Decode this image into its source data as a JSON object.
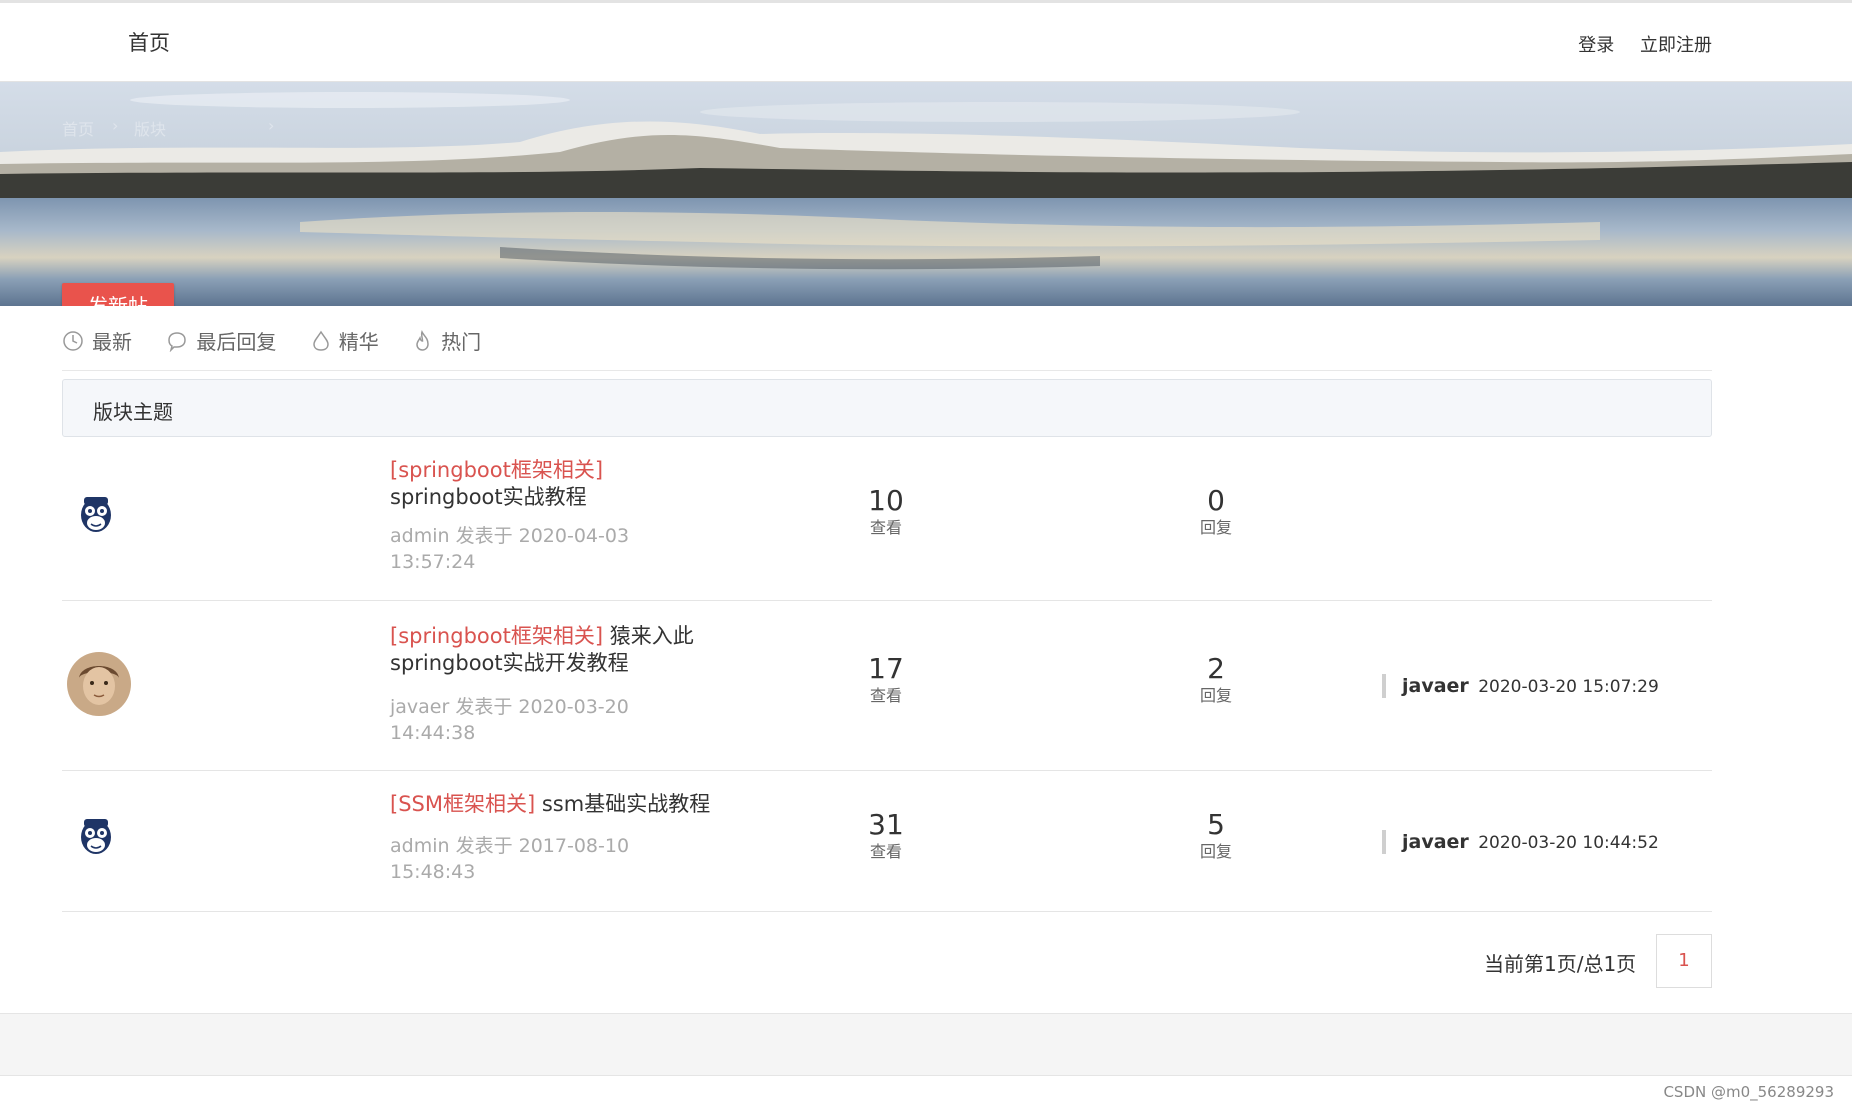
{
  "nav": {
    "home": "首页",
    "login": "登录",
    "register": "立即注册"
  },
  "banner": {
    "crumbs": [
      "首页",
      "›",
      "版块",
      "›"
    ],
    "new_post": "发新帖"
  },
  "tabs": [
    {
      "icon": "clock-icon",
      "label": "最新"
    },
    {
      "icon": "chat-bubble-icon",
      "label": "最后回复"
    },
    {
      "icon": "drop-icon",
      "label": "精华"
    },
    {
      "icon": "flame-icon",
      "label": "热门"
    }
  ],
  "section_title": "版块主题",
  "threads": [
    {
      "avatar": "monkey-avatar-icon",
      "tag": "[springboot框架相关]",
      "title": "springboot实战教程",
      "author": "admin",
      "posted": "发表于 2020-04-03 13:57:24",
      "views": "10",
      "views_label": "查看",
      "replies": "0",
      "replies_label": "回复",
      "last_user": "",
      "last_time": ""
    },
    {
      "avatar": "user-photo-avatar",
      "tag": "[springboot框架相关]",
      "title": "猿来入此springboot实战开发教程",
      "author": "javaer",
      "posted": "发表于 2020-03-20 14:44:38",
      "views": "17",
      "views_label": "查看",
      "replies": "2",
      "replies_label": "回复",
      "last_user": "javaer",
      "last_time": "2020-03-20 15:07:29"
    },
    {
      "avatar": "monkey-avatar-icon",
      "tag": "[SSM框架相关]",
      "title": "ssm基础实战教程",
      "author": "admin",
      "posted": "发表于 2017-08-10 15:48:43",
      "views": "31",
      "views_label": "查看",
      "replies": "5",
      "replies_label": "回复",
      "last_user": "javaer",
      "last_time": "2020-03-20 10:44:52"
    }
  ],
  "pagination": {
    "text": "当前第1页/总1页",
    "current": "1"
  },
  "credit": "CSDN @m0_56289293",
  "colors": {
    "accent": "#e9534c",
    "tag": "#d9534f"
  }
}
